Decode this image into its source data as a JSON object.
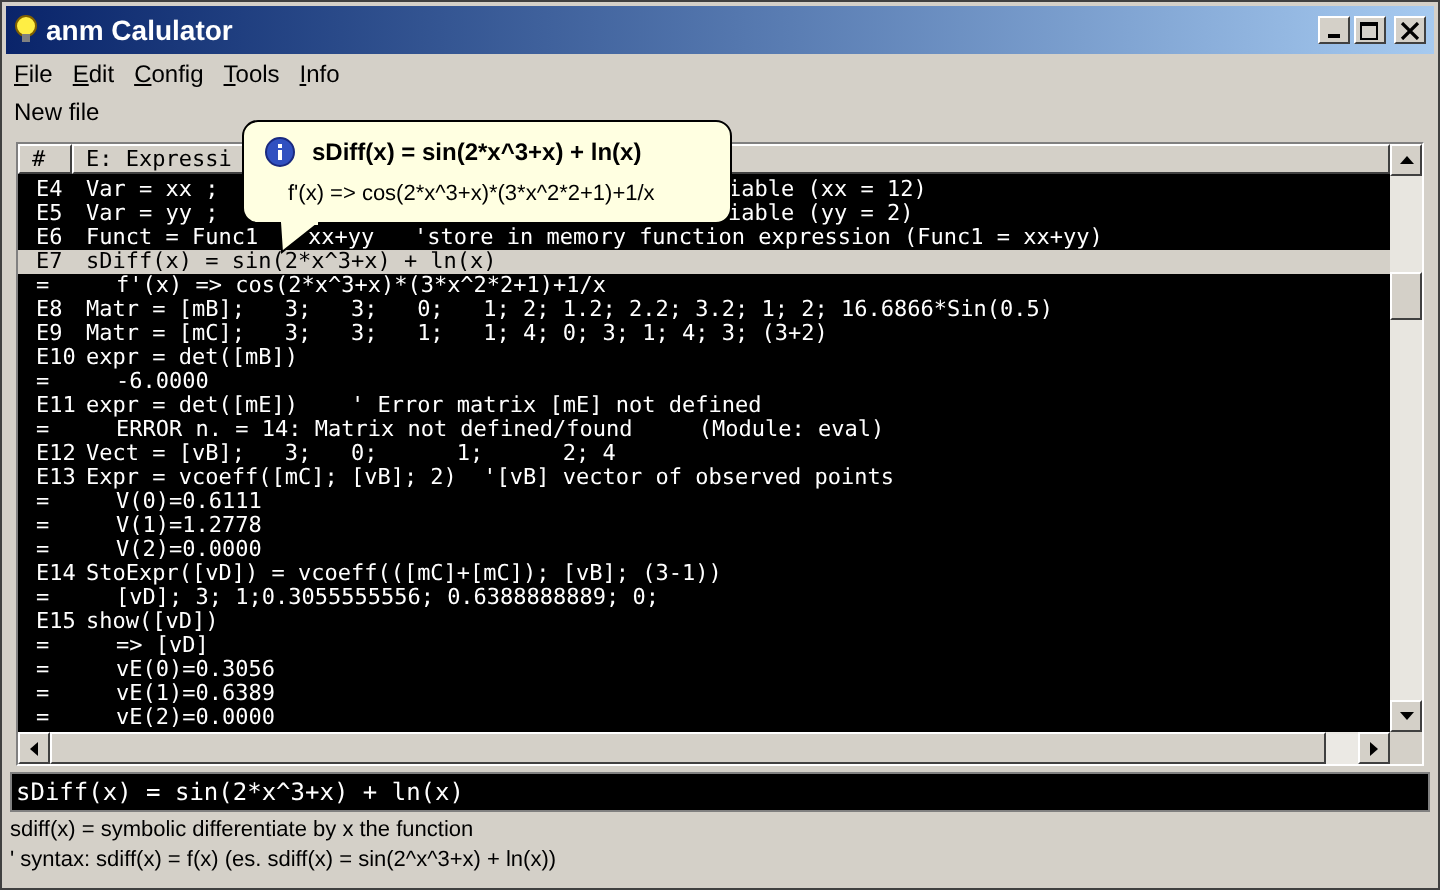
{
  "window": {
    "title": "anm Calulator"
  },
  "menu": [
    {
      "label": "File"
    },
    {
      "label": "Edit"
    },
    {
      "label": "Config"
    },
    {
      "label": "Tools"
    },
    {
      "label": "Info"
    }
  ],
  "toolbar": {
    "label": "New file"
  },
  "table": {
    "columns": [
      "#",
      "E: Expressi"
    ],
    "rows": [
      {
        "id": "E4",
        "kind": "expr",
        "selected": false,
        "code": "Var = xx ;",
        "after_tooltip": "iable (xx = 12)"
      },
      {
        "id": "E5",
        "kind": "expr",
        "selected": false,
        "code": "Var = yy ;",
        "after_tooltip": "iable (yy = 2)"
      },
      {
        "id": "E6",
        "kind": "expr",
        "selected": false,
        "code": "Funct = Func1",
        "after_tail": "xx+yy   'store in memory function expression (Func1 = xx+yy)"
      },
      {
        "id": "E7",
        "kind": "expr",
        "selected": true,
        "code": "sDiff(x) = sin(2*x^3+x) + ln(x)"
      },
      {
        "id": "=",
        "kind": "result",
        "selected": false,
        "code": "f'(x) => cos(2*x^3+x)*(3*x^2*2+1)+1/x"
      },
      {
        "id": "E8",
        "kind": "expr",
        "selected": false,
        "code": "Matr = [mB];   3;   3;   0;   1; 2; 1.2; 2.2; 3.2; 1; 2; 16.6866*Sin(0.5)"
      },
      {
        "id": "E9",
        "kind": "expr",
        "selected": false,
        "code": "Matr = [mC];   3;   3;   1;   1; 4; 0; 3; 1; 4; 3; (3+2)"
      },
      {
        "id": "E10",
        "kind": "expr",
        "selected": false,
        "code": "expr = det([mB])"
      },
      {
        "id": "=",
        "kind": "result",
        "selected": false,
        "code": "-6.0000"
      },
      {
        "id": "E11",
        "kind": "expr",
        "selected": false,
        "code": "expr = det([mE])    ' Error matrix [mE] not defined"
      },
      {
        "id": "=",
        "kind": "result",
        "selected": false,
        "code": "ERROR n. = 14: Matrix not defined/found     (Module: eval)"
      },
      {
        "id": "E12",
        "kind": "expr",
        "selected": false,
        "code": "Vect = [vB];   3;   0;      1;      2; 4"
      },
      {
        "id": "E13",
        "kind": "expr",
        "selected": false,
        "code": "Expr = vcoeff([mC]; [vB]; 2)  '[vB] vector of observed points"
      },
      {
        "id": "=",
        "kind": "result",
        "selected": false,
        "code": "V(0)=0.6111"
      },
      {
        "id": "=",
        "kind": "result",
        "selected": false,
        "code": "V(1)=1.2778"
      },
      {
        "id": "=",
        "kind": "result",
        "selected": false,
        "code": "V(2)=0.0000"
      },
      {
        "id": "E14",
        "kind": "expr",
        "selected": false,
        "code": "StoExpr([vD]) = vcoeff(([mC]+[mC]); [vB]; (3-1))"
      },
      {
        "id": "=",
        "kind": "result",
        "selected": false,
        "code": "[vD]; 3; 1;0.3055555556; 0.6388888889; 0;"
      },
      {
        "id": "E15",
        "kind": "expr",
        "selected": false,
        "code": "show([vD])"
      },
      {
        "id": "=",
        "kind": "result",
        "selected": false,
        "code": "=> [vD]"
      },
      {
        "id": "=",
        "kind": "result",
        "selected": false,
        "code": "vE(0)=0.3056"
      },
      {
        "id": "=",
        "kind": "result",
        "selected": false,
        "code": "vE(1)=0.6389"
      },
      {
        "id": "=",
        "kind": "result",
        "selected": false,
        "code": "vE(2)=0.0000"
      }
    ]
  },
  "tooltip": {
    "title": "sDiff(x) = sin(2*x^3+x) + ln(x)",
    "body": "f'(x) => cos(2*x^3+x)*(3*x^2*2+1)+1/x"
  },
  "input": {
    "value": "sDiff(x) = sin(2*x^3+x) + ln(x)"
  },
  "status_bar": [
    "sdiff(x) = symbolic differentiate by x the function",
    "' syntax: sdiff(x) = f(x) (es. sdiff(x) = sin(2^x^3+x) + ln(x))"
  ]
}
